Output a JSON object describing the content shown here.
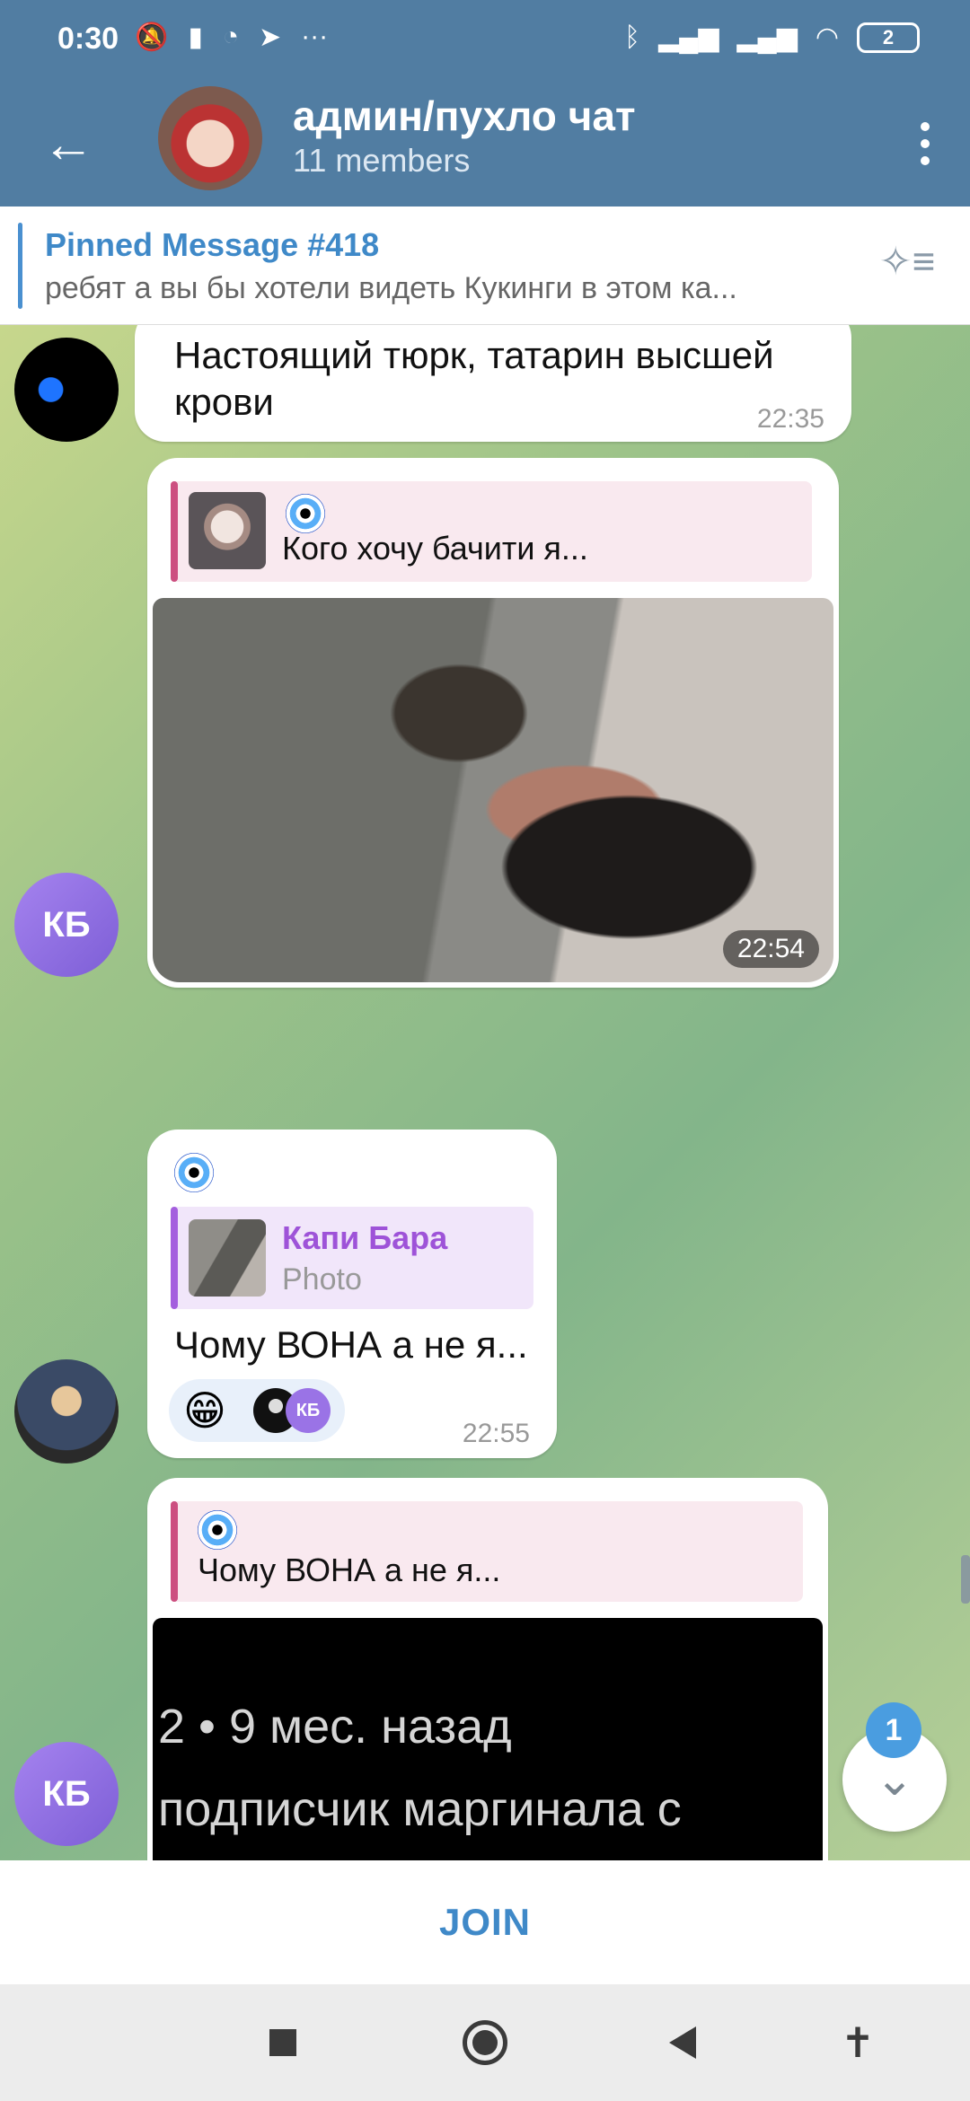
{
  "status_bar": {
    "time": "0:30",
    "battery": "2",
    "left_icons": [
      "bell-muted-icon",
      "battery-saver-icon",
      "chat-icon",
      "telegram-icon",
      "more-dots-icon"
    ],
    "right_icons": [
      "bluetooth-icon",
      "signal-icon",
      "signal-icon",
      "wifi-icon"
    ]
  },
  "header": {
    "title": "админ/пухло чат",
    "subtitle": "11 members",
    "back_icon": "arrow-left-icon",
    "menu_icon": "more-vertical-icon"
  },
  "pinned": {
    "title": "Pinned Message #418",
    "text": "ребят а вы бы хотели видеть Кукинги в этом ка..."
  },
  "messages": {
    "m1": {
      "text": "Настоящий тюрк, татарин высшей крови",
      "time": "22:35"
    },
    "m2": {
      "reply_text": "Кого хочу бачити я...",
      "photo_time": "22:54",
      "sender_initials": "КБ"
    },
    "m3": {
      "reply_sender": "Капи Бара",
      "reply_sub": "Photo",
      "text": "Чому ВОНА а не я...",
      "time": "22:55",
      "reaction_emoji": "😁",
      "reaction_initials": "КБ"
    },
    "m4": {
      "reply_text": "Чому ВОНА а не я...",
      "video_line1": "2 • 9 мес. назад",
      "video_line2": "подписчик маргинала с",
      "sender_initials": "КБ"
    }
  },
  "scroll": {
    "unread_count": "1"
  },
  "join_label": "JOIN",
  "accent_color": "#517da2"
}
